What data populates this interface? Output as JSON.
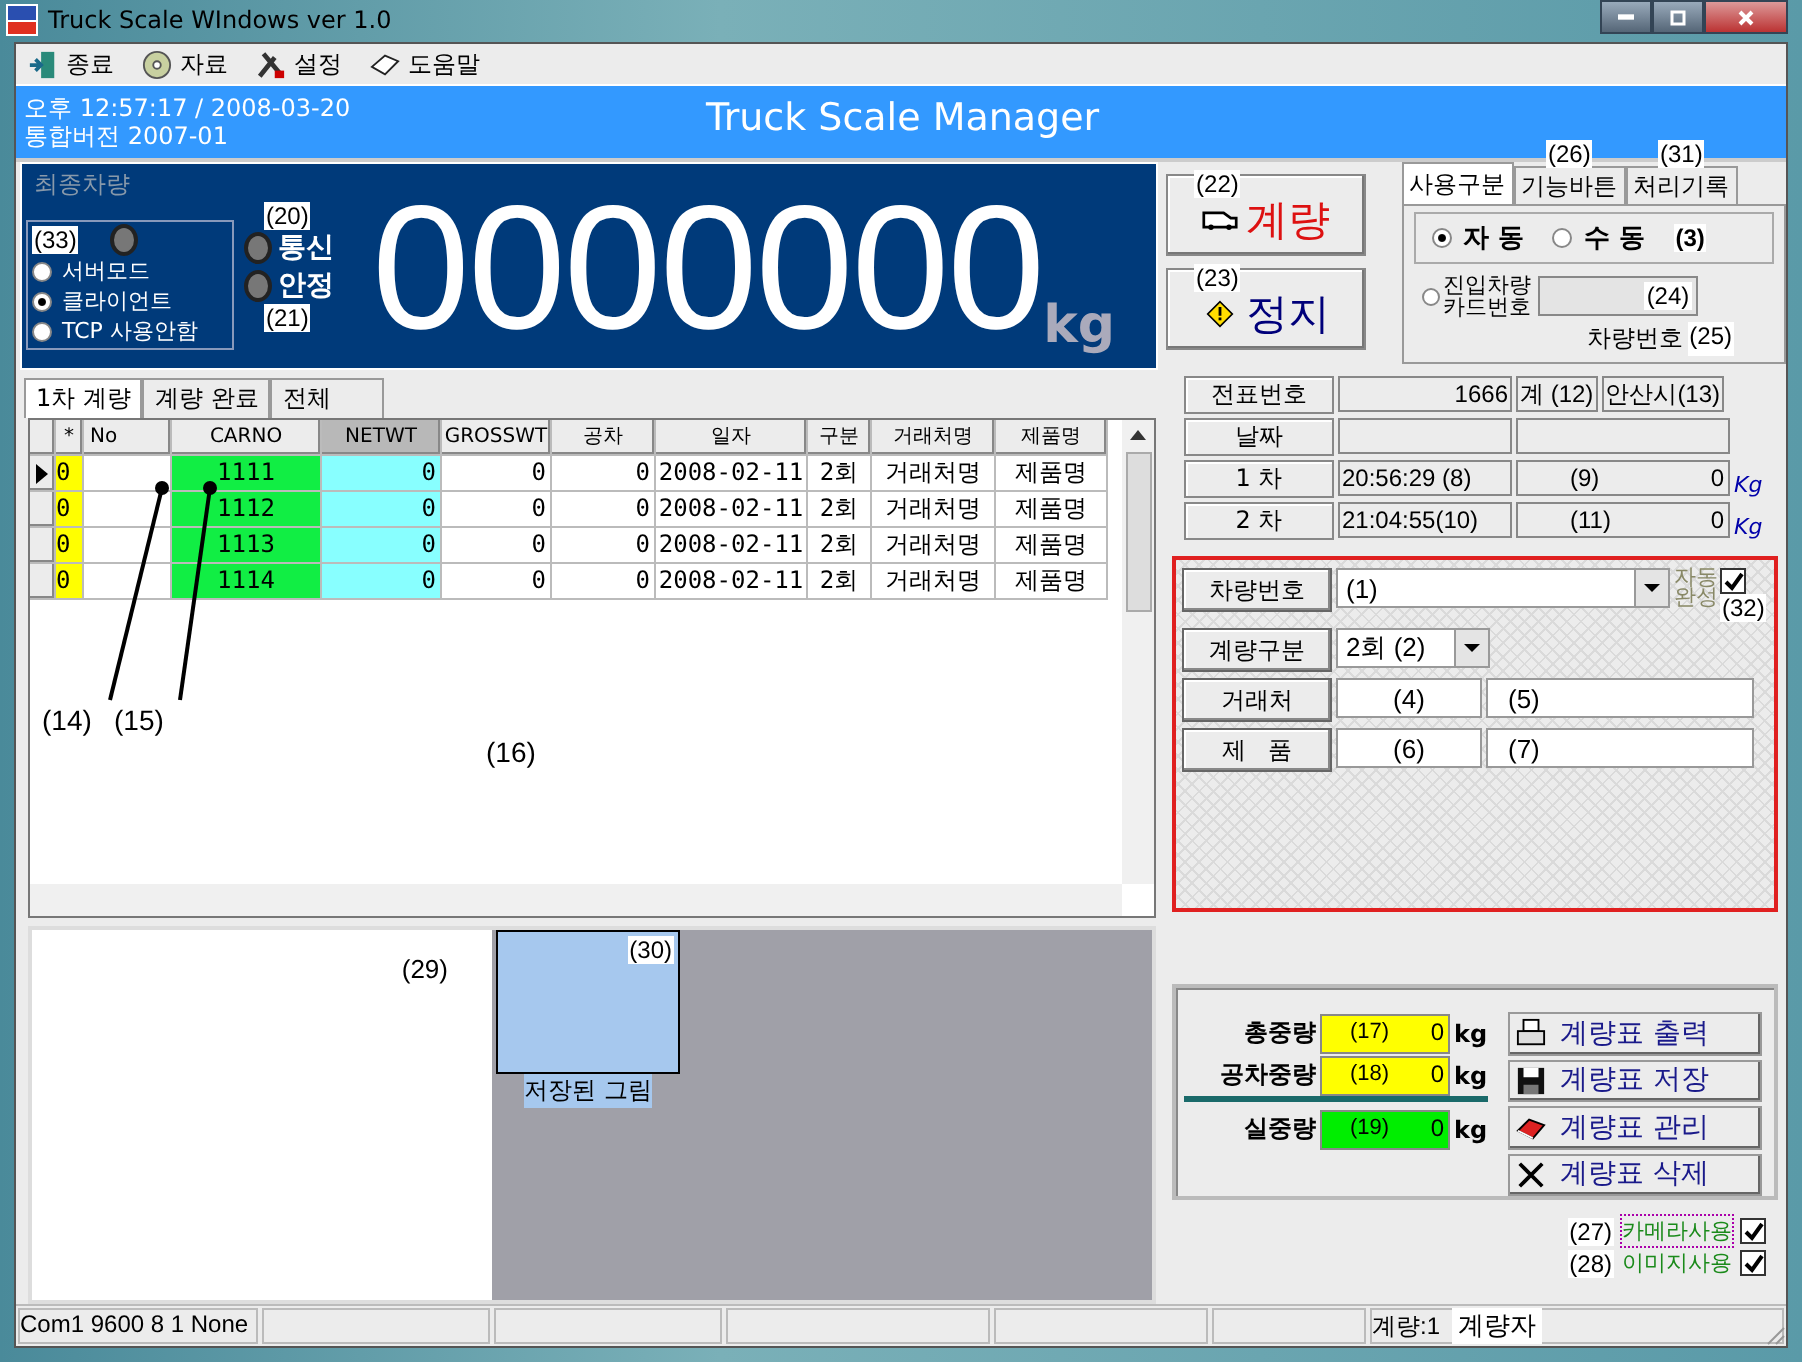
{
  "window": {
    "title": "Truck Scale WIndows ver 1.0"
  },
  "menu": [
    {
      "label": "종료",
      "kind": "exit"
    },
    {
      "label": "자료",
      "kind": "disc"
    },
    {
      "label": "설정",
      "kind": "tools"
    },
    {
      "label": "도움말",
      "kind": "help"
    }
  ],
  "header": {
    "time": "오후 12:57:17 / 2008-03-20",
    "version": "통합버전 2007-01",
    "title": "Truck Scale Manager"
  },
  "display": {
    "caption": "최종차량",
    "mode_tag": "(33)",
    "modes": [
      {
        "label": "서버모드",
        "selected": false
      },
      {
        "label": "클라이언트",
        "selected": true
      },
      {
        "label": "TCP 사용안함",
        "selected": false
      }
    ],
    "lamps": [
      {
        "label": "통신",
        "tag": "(20)"
      },
      {
        "label": "안정",
        "tag": "(21)"
      }
    ],
    "weight": "0000000",
    "unit": "kg"
  },
  "actions": [
    {
      "tag": "(22)",
      "label": "계량",
      "kind": "weigh"
    },
    {
      "tag": "(23)",
      "label": "정지",
      "kind": "stop"
    }
  ],
  "side_tabs": {
    "tabs": [
      {
        "label": "사용구분",
        "selected": true
      },
      {
        "label": "기능바튼",
        "tag": "(26)",
        "selected": false
      },
      {
        "label": "처리기록",
        "tag": "(31)",
        "selected": false
      }
    ],
    "auto_modes": [
      {
        "label": "자 동",
        "selected": true
      },
      {
        "label": "수 동",
        "selected": false
      }
    ],
    "auto_tag": "(3)",
    "card_label_lines": [
      "진입차량",
      "카드번호"
    ],
    "card_selected": false,
    "card_tag": "(24)",
    "vehicle_label": "차량번호",
    "vehicle_tag": "(25)"
  },
  "list_tabs": [
    {
      "label": "1차 계량",
      "selected": true
    },
    {
      "label": "계량 완료",
      "selected": false
    },
    {
      "label": "전체",
      "selected": false
    }
  ],
  "table": {
    "columns": [
      "*",
      "No",
      "CARNO",
      "NETWT",
      "GROSSWT",
      "공차",
      "일자",
      "구분",
      "거래처명",
      "제품명"
    ],
    "rows": [
      {
        "selected": true,
        "cells": [
          "0",
          "",
          "1111",
          "0",
          "0",
          "0",
          "2008-02-11",
          "2회",
          "거래처명",
          "제품명"
        ]
      },
      {
        "selected": false,
        "cells": [
          "0",
          "",
          "1112",
          "0",
          "0",
          "0",
          "2008-02-11",
          "2회",
          "거래처명",
          "제품명"
        ]
      },
      {
        "selected": false,
        "cells": [
          "0",
          "",
          "1113",
          "0",
          "0",
          "0",
          "2008-02-11",
          "2회",
          "거래처명",
          "제품명"
        ]
      },
      {
        "selected": false,
        "cells": [
          "0",
          "",
          "1114",
          "0",
          "0",
          "0",
          "2008-02-11",
          "2회",
          "거래처명",
          "제품명"
        ]
      }
    ],
    "tags": [
      "(14)",
      "(15)",
      "(16)"
    ]
  },
  "images": {
    "camera_tag": "(29)",
    "thumb_tag": "(30)",
    "thumb_caption": "저장된 그림"
  },
  "info": {
    "slip_label": "전표번호",
    "slip_no": "1666",
    "slip_tag": "계 (12)",
    "city": "안산시(13)",
    "date_label": "날짜",
    "passes": [
      {
        "label": "1 차",
        "time": "20:56:29 (8)",
        "tag": "(9)",
        "weight": "0",
        "unit": "Kg"
      },
      {
        "label": "2 차",
        "time": "21:04:55(10)",
        "tag": "(11)",
        "weight": "0",
        "unit": "Kg"
      }
    ]
  },
  "entry": {
    "vehicle_label": "차량번호",
    "vehicle_value": "(1)",
    "auto_label_lines": [
      "자동",
      "완성"
    ],
    "auto_checked": true,
    "auto_tag": "(32)",
    "type_label": "계량구분",
    "type_value": "2회 (2)",
    "client_label": "거래처",
    "client_fields": [
      "(4)",
      "(5)"
    ],
    "product_label": "제   품",
    "product_fields": [
      "(6)",
      "(7)"
    ]
  },
  "totals": [
    {
      "label": "총중량",
      "tag": "(17)",
      "value": "0",
      "unit": "kg",
      "color": "#ffff00"
    },
    {
      "label": "공차중량",
      "tag": "(18)",
      "value": "0",
      "unit": "kg",
      "color": "#ffff00"
    },
    {
      "label": "실중량",
      "tag": "(19)",
      "value": "0",
      "unit": "kg",
      "color": "#00ee00"
    }
  ],
  "report_buttons": [
    {
      "label": "계량표 출력",
      "kind": "print"
    },
    {
      "label": "계량표 저장",
      "kind": "save"
    },
    {
      "label": "계량표 관리",
      "kind": "manage"
    },
    {
      "label": "계량표 삭제",
      "kind": "delete"
    }
  ],
  "options": [
    {
      "tag": "(27)",
      "label": "카메라사용",
      "checked": true
    },
    {
      "tag": "(28)",
      "label": "이미지사용",
      "checked": true
    }
  ],
  "status_bar": {
    "port": "Com1 9600 8 1 None",
    "counter": "계량:1",
    "user": "계량자"
  }
}
